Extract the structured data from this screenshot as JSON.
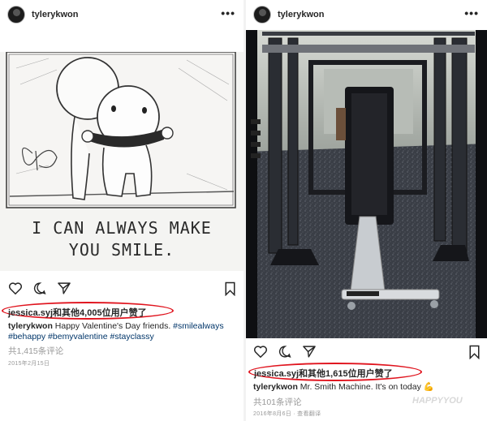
{
  "left_post": {
    "username": "tylerykwon",
    "image_text": "I CAN ALWAYS MAKE YOU SMILE.",
    "likes": "jessica.syj和其他4,005位用户赞了",
    "caption_user": "tylerykwon",
    "caption_text": "Happy Valentine's Day friends.",
    "hashtags_line1": "#smilealways",
    "hashtags_line2": "#behappy #bemyvalentine #stayclassy",
    "comments": "共1,415条评论",
    "date": "2015年2月15日"
  },
  "right_post": {
    "username": "tylerykwon",
    "likes": "jessica.syj和其他1,615位用户赞了",
    "caption_user": "tylerykwon",
    "caption_text": "Mr. Smith Machine. It's on today",
    "comments": "共101条评论",
    "date": "2016年8月6日 · 查看翻译"
  },
  "watermark": "HAPPYYOU",
  "colors": {
    "highlight_oval": "#e0141e",
    "hashtag": "#003569",
    "muted": "#999999"
  },
  "icons": [
    "heart-icon",
    "comment-icon",
    "share-icon",
    "bookmark-icon",
    "more-icon"
  ]
}
